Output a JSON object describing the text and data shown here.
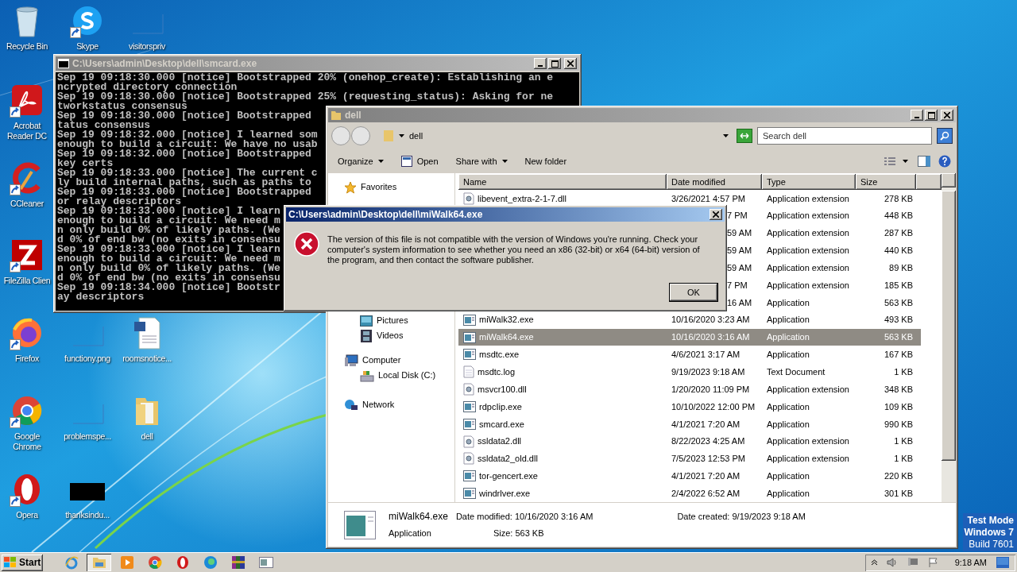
{
  "desktop_icons": [
    {
      "label": "Recycle Bin",
      "kind": "recycle",
      "shortcut": false
    },
    {
      "label": "Skype",
      "kind": "skype",
      "shortcut": true
    },
    {
      "label": "visitorspriv",
      "kind": "blank",
      "shortcut": false
    },
    {
      "label": "Acrobat Reader DC",
      "kind": "acrobat",
      "shortcut": true
    },
    {
      "label": "CCleaner",
      "kind": "ccleaner",
      "shortcut": true
    },
    {
      "label": "FileZilla Clien",
      "kind": "filezilla",
      "shortcut": true
    },
    {
      "label": "Firefox",
      "kind": "firefox",
      "shortcut": true
    },
    {
      "label": "functiony.png",
      "kind": "blank",
      "shortcut": false
    },
    {
      "label": "roomsnotice...",
      "kind": "word",
      "shortcut": false
    },
    {
      "label": "Google Chrome",
      "kind": "chrome",
      "shortcut": true
    },
    {
      "label": "problemspe...",
      "kind": "blank",
      "shortcut": false
    },
    {
      "label": "dell",
      "kind": "folder",
      "shortcut": false
    },
    {
      "label": "Opera",
      "kind": "opera",
      "shortcut": true
    },
    {
      "label": "thanksindu...",
      "kind": "dark",
      "shortcut": false
    }
  ],
  "console": {
    "title": "C:\\Users\\admin\\Desktop\\dell\\smcard.exe",
    "lines": [
      "Sep 19 09:18:30.000 [notice] Bootstrapped 20% (onehop_create): Establishing an e",
      "ncrypted directory connection",
      "Sep 19 09:18:30.000 [notice] Bootstrapped 25% (requesting_status): Asking for ne",
      "tworkstatus consensus",
      "Sep 19 09:18:30.000 [notice] Bootstrapped",
      "tatus consensus",
      "Sep 19 09:18:32.000 [notice] I learned som",
      "enough to build a circuit: We have no usab",
      "Sep 19 09:18:32.000 [notice] Bootstrapped",
      "key certs",
      "Sep 19 09:18:33.000 [notice] The current c",
      "ly build internal paths, such as paths to",
      "Sep 19 09:18:33.000 [notice] Bootstrapped",
      "or relay descriptors",
      "Sep 19 09:18:33.000 [notice] I learn",
      "enough to build a circuit: We need m",
      "n only build 0% of likely paths. (We",
      "d 0% of end bw (no exits in consensu",
      "Sep 19 09:18:33.000 [notice] I learn",
      "enough to build a circuit: We need m",
      "n only build 0% of likely paths. (We",
      "d 0% of end bw (no exits in consensu",
      "Sep 19 09:18:34.000 [notice] Bootstr",
      "ay descriptors"
    ]
  },
  "explorer": {
    "title": "dell",
    "address": "dell",
    "search": {
      "placeholder": "Search dell"
    },
    "toolbar": [
      {
        "label": "Organize",
        "kind": "menu"
      },
      {
        "label": "Open",
        "kind": "open"
      },
      {
        "label": "Share with",
        "kind": "menu"
      },
      {
        "label": "New folder",
        "kind": "plain"
      }
    ],
    "nav": [
      {
        "label": "Favorites",
        "kind": "star"
      },
      {
        "children": [
          {
            "label": "Pictures",
            "kind": "pictures"
          },
          {
            "label": "Videos",
            "kind": "videos"
          }
        ]
      },
      {
        "label": "Computer",
        "kind": "computer",
        "children": [
          {
            "label": "Local Disk (C:)",
            "kind": "disk"
          }
        ]
      },
      {
        "label": "Network",
        "kind": "network"
      }
    ],
    "columns": [
      "Name",
      "Date modified",
      "Type",
      "Size"
    ],
    "rows": [
      {
        "name": "libevent_extra-2-1-7.dll",
        "kind": "dll",
        "date": "3/26/2021 4:57 PM",
        "type": "Application extension",
        "size": "278 KB",
        "selected": false
      },
      {
        "date": "7 PM",
        "type": "Application extension",
        "size": "448 KB",
        "selected": false
      },
      {
        "date": "59 AM",
        "type": "Application extension",
        "size": "287 KB",
        "selected": false
      },
      {
        "date": "59 AM",
        "type": "Application extension",
        "size": "440 KB",
        "selected": false
      },
      {
        "date": "59 AM",
        "type": "Application extension",
        "size": "89 KB",
        "selected": false
      },
      {
        "date": "7 PM",
        "type": "Application extension",
        "size": "185 KB",
        "selected": false
      },
      {
        "date": "16 AM",
        "type": "Application",
        "size": "563 KB",
        "selected": false
      },
      {
        "name": "miWalk32.exe",
        "kind": "exe",
        "date": "10/16/2020 3:23 AM",
        "type": "Application",
        "size": "493 KB",
        "selected": false
      },
      {
        "name": "miWalk64.exe",
        "kind": "exe",
        "date": "10/16/2020 3:16 AM",
        "type": "Application",
        "size": "563 KB",
        "selected": true
      },
      {
        "name": "msdtc.exe",
        "kind": "exe",
        "date": "4/6/2021 3:17 AM",
        "type": "Application",
        "size": "167 KB",
        "selected": false
      },
      {
        "name": "msdtc.log",
        "kind": "txt",
        "date": "9/19/2023 9:18 AM",
        "type": "Text Document",
        "size": "1 KB",
        "selected": false
      },
      {
        "name": "msvcr100.dll",
        "kind": "dll",
        "date": "1/20/2020 11:09 PM",
        "type": "Application extension",
        "size": "348 KB",
        "selected": false
      },
      {
        "name": "rdpcIip.exe",
        "kind": "exe",
        "date": "10/10/2022 12:00 PM",
        "type": "Application",
        "size": "109 KB",
        "selected": false
      },
      {
        "name": "smcard.exe",
        "kind": "exe",
        "date": "4/1/2021 7:20 AM",
        "type": "Application",
        "size": "990 KB",
        "selected": false
      },
      {
        "name": "ssldata2.dll",
        "kind": "dll",
        "date": "8/22/2023 4:25 AM",
        "type": "Application extension",
        "size": "1 KB",
        "selected": false
      },
      {
        "name": "ssldata2_old.dll",
        "kind": "dll",
        "date": "7/5/2023 12:53 PM",
        "type": "Application extension",
        "size": "1 KB",
        "selected": false
      },
      {
        "name": "tor-gencert.exe",
        "kind": "exe",
        "date": "4/1/2021 7:20 AM",
        "type": "Application",
        "size": "220 KB",
        "selected": false
      },
      {
        "name": "windrlver.exe",
        "kind": "exe",
        "date": "2/4/2022 6:52 AM",
        "type": "Application",
        "size": "301 KB",
        "selected": false
      }
    ],
    "details": {
      "name": "miWalk64.exe",
      "type": "Application",
      "fields": [
        {
          "label": "Date modified:",
          "value": "10/16/2020 3:16 AM"
        },
        {
          "label": "Date created:",
          "value": "9/19/2023 9:18 AM"
        },
        {
          "label": "Size:",
          "value": "563 KB"
        }
      ]
    }
  },
  "dialog": {
    "title": "C:\\Users\\admin\\Desktop\\dell\\miWalk64.exe",
    "message": "The version of this file is not compatible with the version of Windows you're running. Check your computer's system information to see whether you need an x86 (32-bit) or x64 (64-bit) version of the program, and then contact the software publisher.",
    "button": "OK"
  },
  "taskbar": {
    "start": "Start",
    "apps": [
      {
        "kind": "ie",
        "active": false
      },
      {
        "kind": "explorer",
        "active": true
      },
      {
        "kind": "media",
        "active": false
      },
      {
        "kind": "chrome",
        "active": false
      },
      {
        "kind": "opera",
        "active": false
      },
      {
        "kind": "edge",
        "active": false
      },
      {
        "kind": "winrar",
        "active": false
      },
      {
        "kind": "window",
        "active": false
      }
    ],
    "clock": "9:18 AM"
  },
  "test_mode": [
    "Test Mode",
    "Windows 7",
    "Build 7601"
  ]
}
